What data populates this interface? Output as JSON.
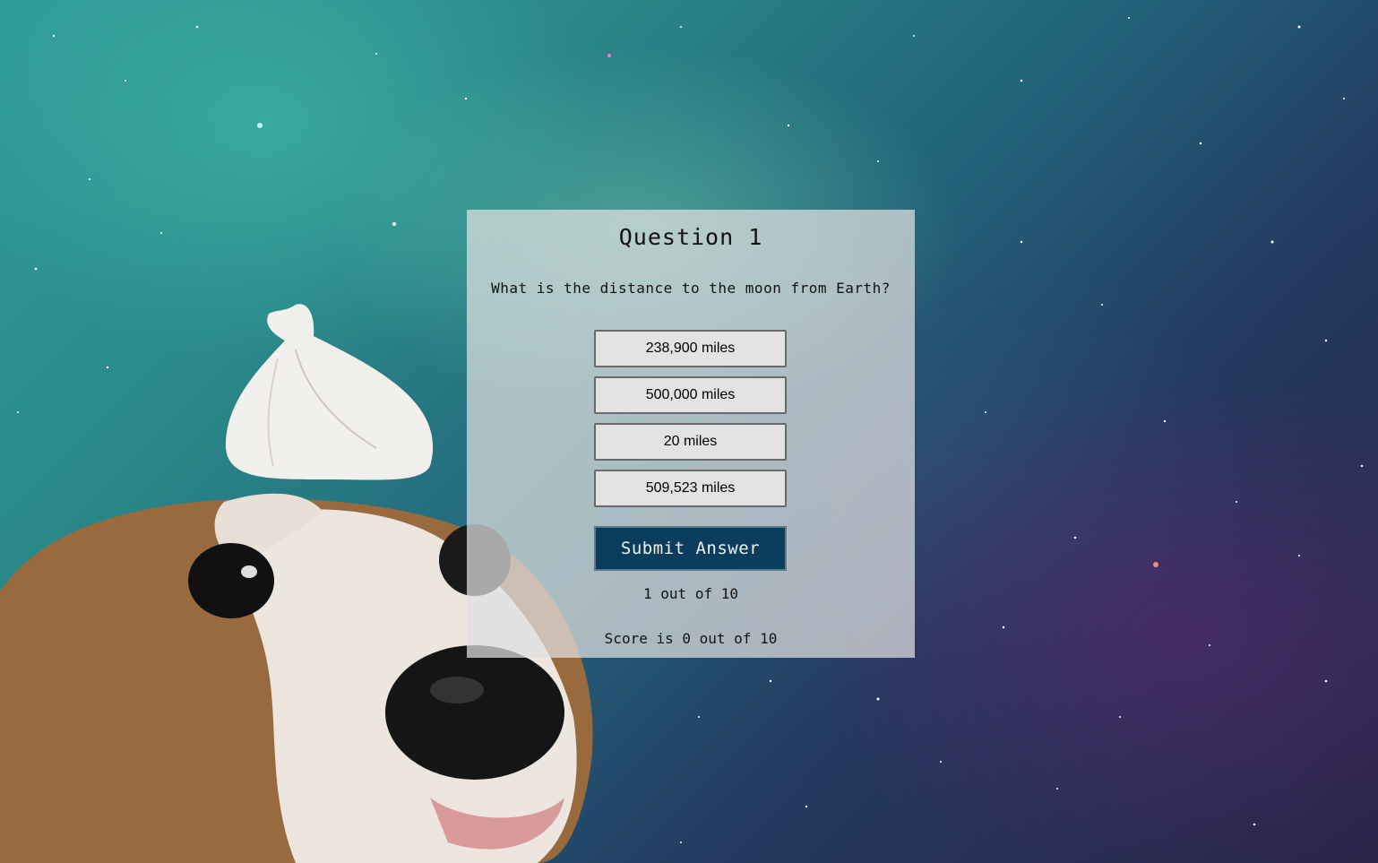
{
  "quiz": {
    "title": "Question 1",
    "question": "What is the distance to the moon from Earth?",
    "answers": [
      "238,900 miles",
      "500,000 miles",
      "20 miles",
      "509,523 miles"
    ],
    "submit_label": "Submit Answer",
    "progress": "1 out of 10",
    "score": "Score is 0 out of 10"
  },
  "background": {
    "description_icon": "space-nebula-background",
    "dog_icon": "dog-with-garlic-icon"
  }
}
